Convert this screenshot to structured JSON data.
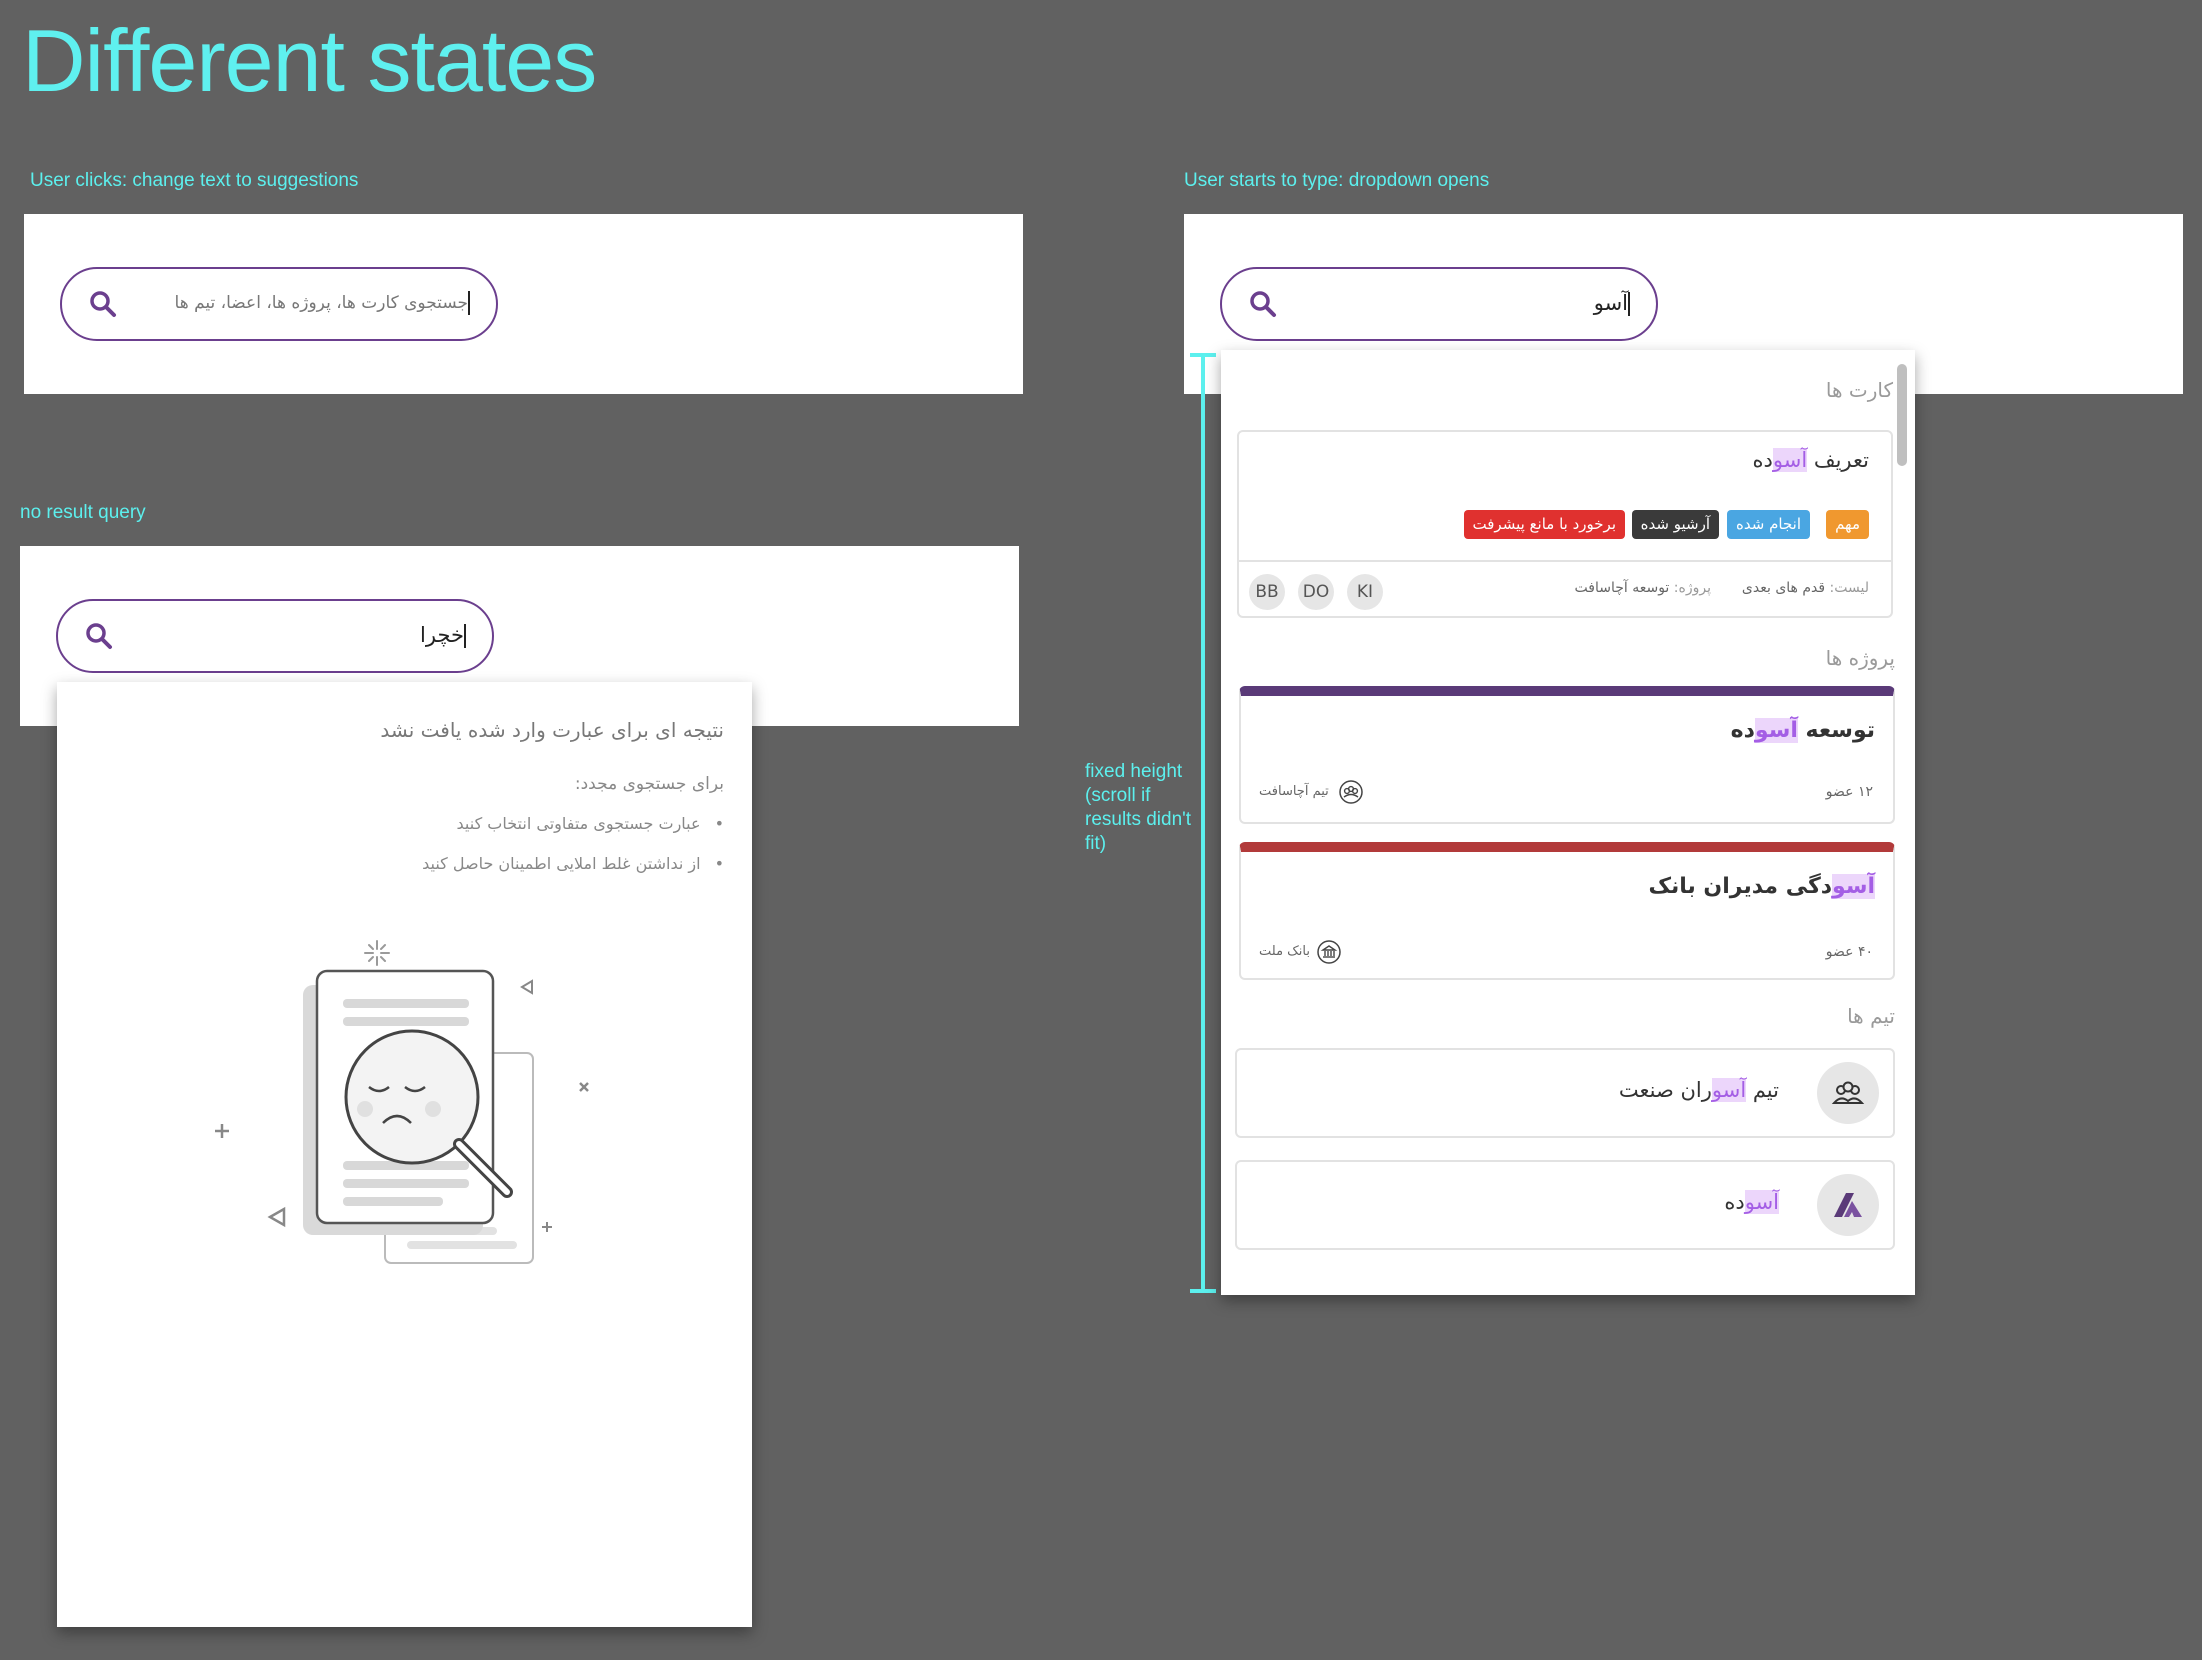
{
  "header": {
    "title": "Different states"
  },
  "states": {
    "click": {
      "caption": "User clicks: change text to suggestions",
      "placeholder": "جستجوی کارت ها، پروژه ها، اعضا، تیم ها"
    },
    "no_result": {
      "caption": "no result query",
      "query": "خچرا",
      "heading": "نتیجه ای برای عبارت وارد شده یافت نشد",
      "subheading": "برای جستجوی مجدد:",
      "tips": [
        "عبارت جستجوی متفاوتی انتخاب کنید",
        "از نداشتن غلط املایی اطمینان حاصل کنید"
      ]
    },
    "typing": {
      "caption": "User starts to type: dropdown opens",
      "query": "آسو",
      "annotation": "fixed height (scroll if results didn't fit)"
    }
  },
  "dropdown": {
    "cards_section": "کارت ها",
    "card": {
      "title_prefix": "تعریف ",
      "title_match": "آسو",
      "title_suffix": "ده",
      "tags": [
        {
          "label": "مهم",
          "color": "#f0982f"
        },
        {
          "label": "انجام شده",
          "color": "#4aa6e2"
        },
        {
          "label": "آرشیو شده",
          "color": "#3a3a3a"
        },
        {
          "label": "برخورد با مانع پیشرفت",
          "color": "#e0312f"
        }
      ],
      "list_label": "لیست:",
      "list_value": "قدم های بعدی",
      "project_label": "پروژه:",
      "project_value": "توسعه آچاسافت",
      "avatars": [
        "KI",
        "DO",
        "BB"
      ]
    },
    "projects_section": "پروژه ها",
    "projects": [
      {
        "title_prefix": "توسعه ",
        "title_match": "آسو",
        "title_suffix": "ده",
        "members": "۱۲ عضو",
        "team": "تیم آچاسافت",
        "color": "#5a3a78",
        "icon": "team-icon"
      },
      {
        "title_prefix": "",
        "title_match": "آسو",
        "title_suffix": "دگی مدیران بانک",
        "members": "۴۰ عضو",
        "team": "بانک ملت",
        "color": "#b23a3a",
        "icon": "bank-icon"
      }
    ],
    "teams_section": "تیم ها",
    "teams": [
      {
        "prefix": "تیم ",
        "match": "آسو",
        "suffix": "ران صنعت",
        "icon": "team-icon"
      },
      {
        "prefix": "",
        "match": "آسو",
        "suffix": "ده",
        "icon": "logo-icon"
      }
    ]
  }
}
